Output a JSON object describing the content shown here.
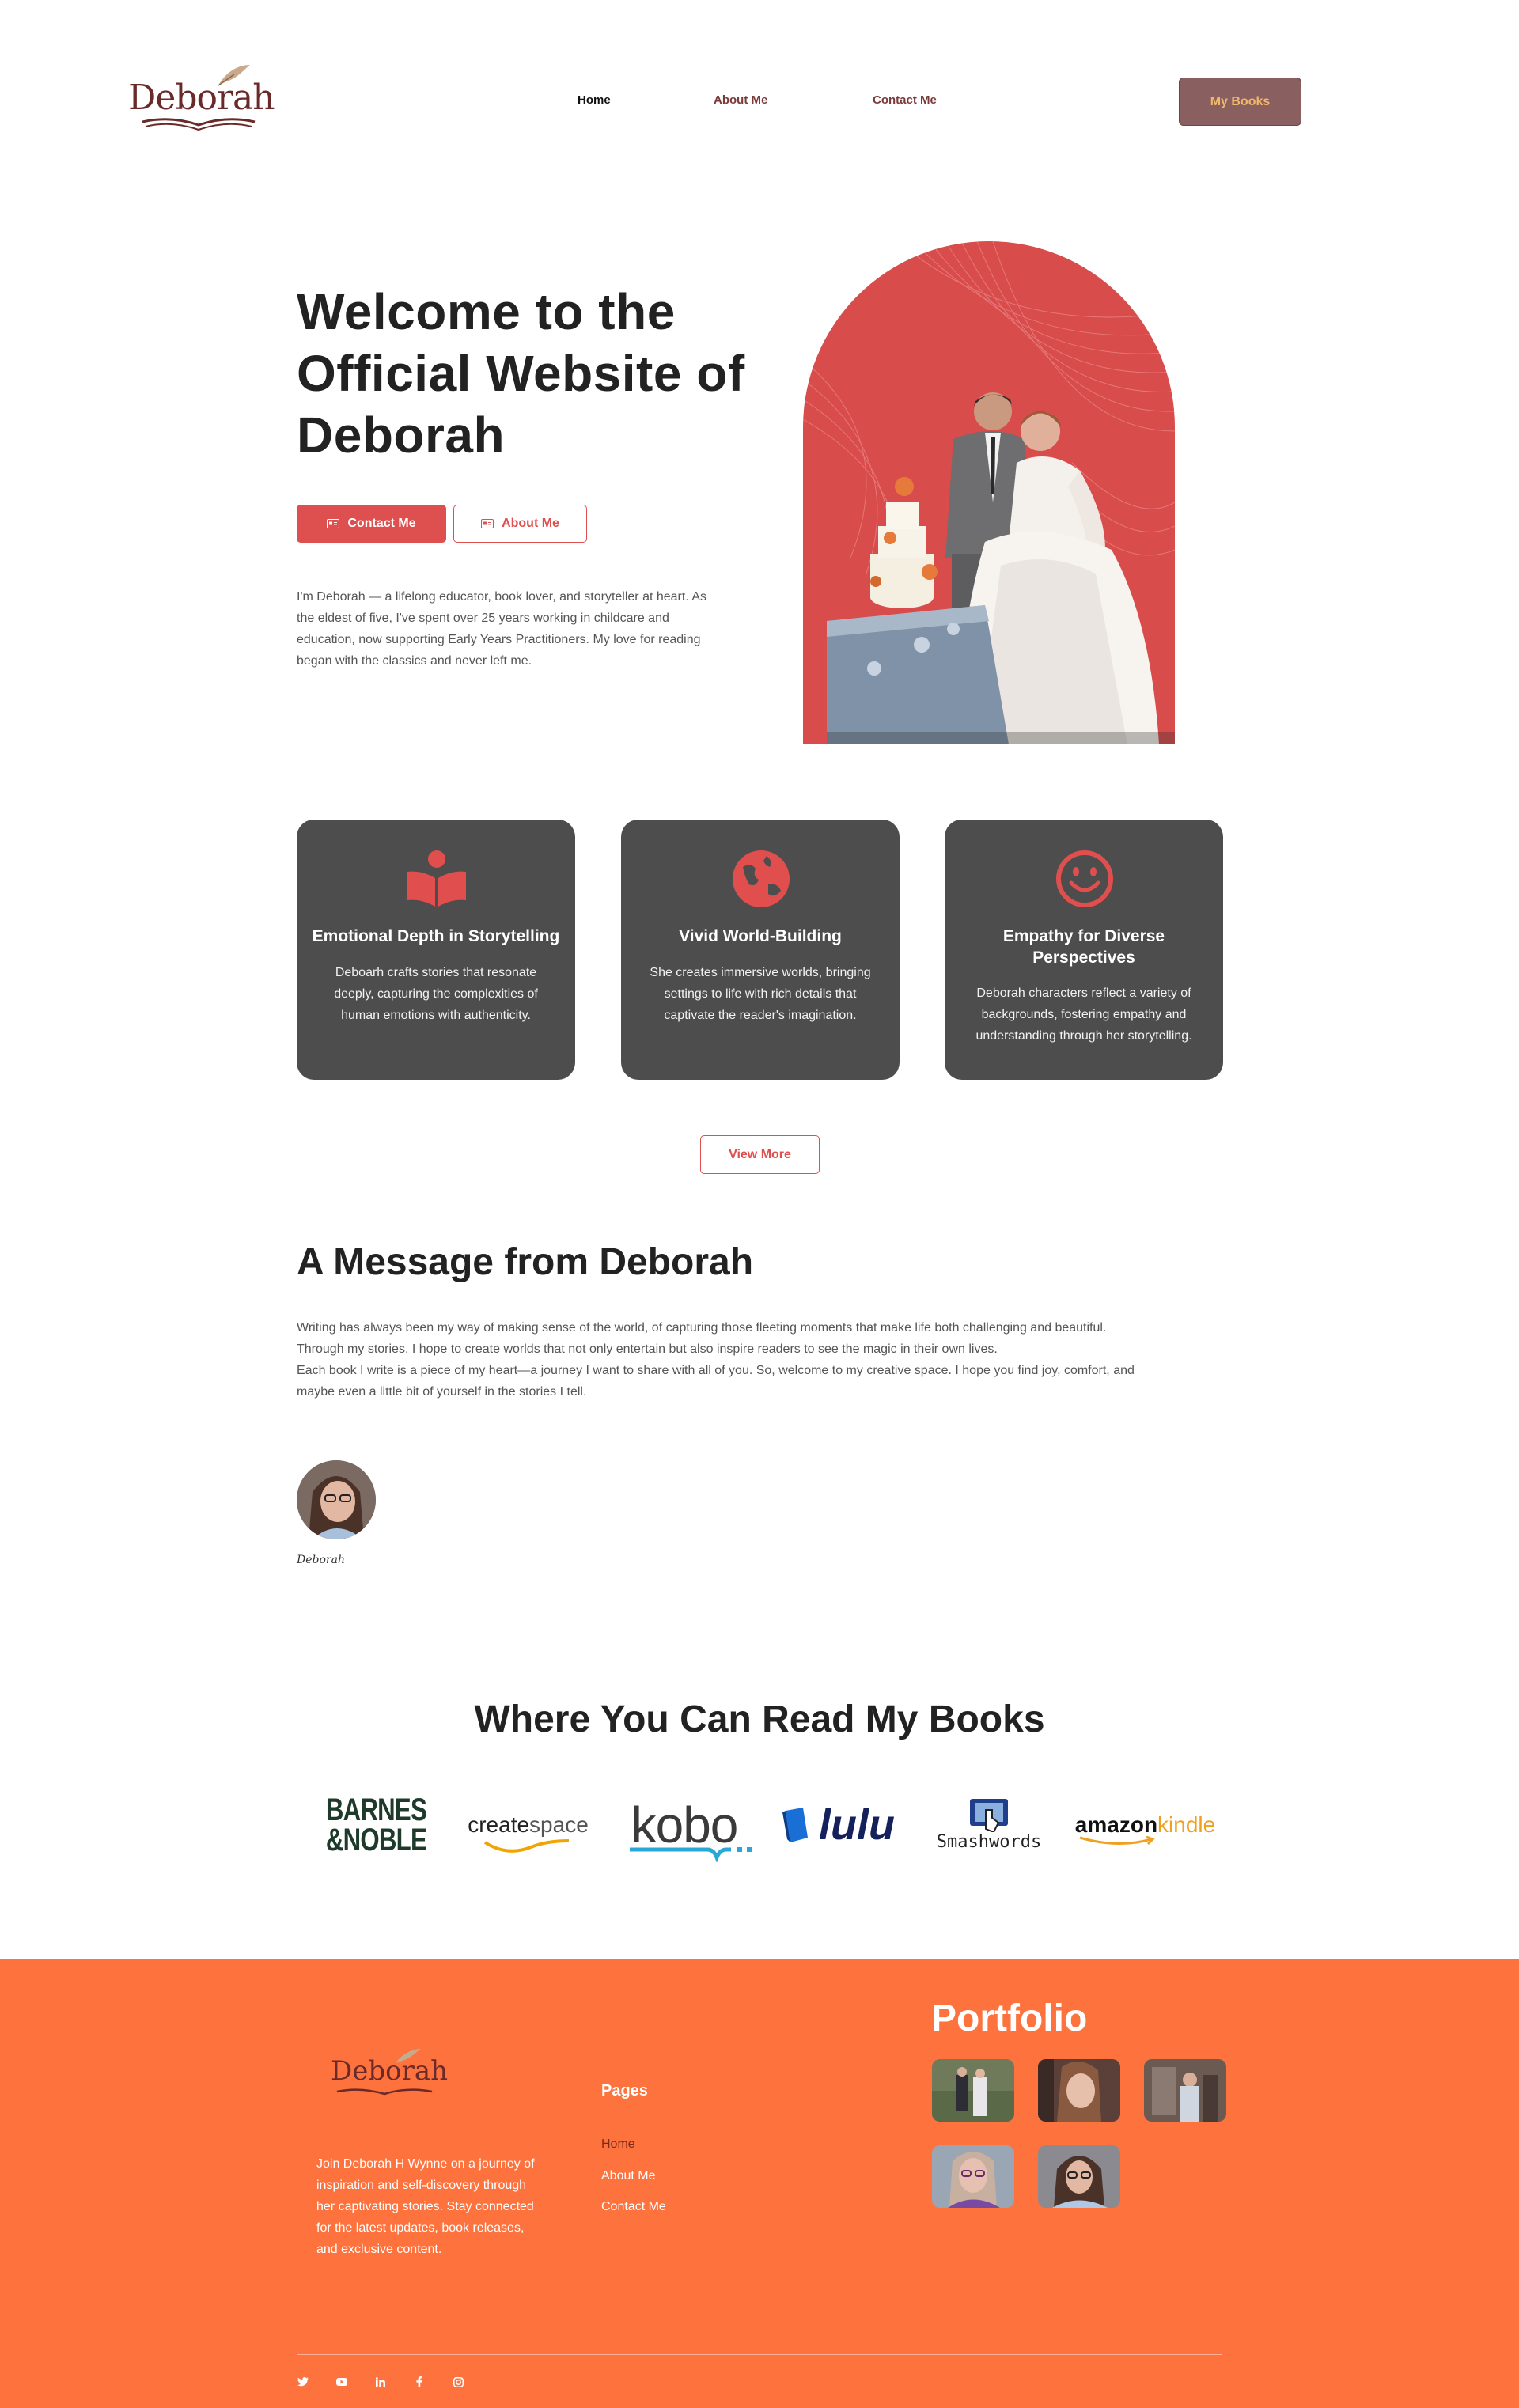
{
  "nav": {
    "logo_text": "Deborah",
    "links": [
      "Home",
      "About Me",
      "Contact Me"
    ],
    "cta": "My Books"
  },
  "hero": {
    "title": "Welcome to the Official Website of Deborah",
    "btn_contact": "Contact Me",
    "btn_about": "About Me",
    "paragraph": "I'm Deborah — a lifelong educator, book lover, and storyteller at heart. As the eldest of five, I've spent over 25 years working in childcare and education, now supporting Early Years Practitioners. My love for reading began with the classics and never left me."
  },
  "features": [
    {
      "icon": "reading-person-icon",
      "title": "Emotional Depth in Storytelling",
      "text": "Deboarh crafts stories that resonate deeply, capturing the complexities of human emotions with authenticity."
    },
    {
      "icon": "globe-icon",
      "title": "Vivid World-Building",
      "text": "She creates immersive worlds, bringing settings to life with rich details that captivate the reader's imagination."
    },
    {
      "icon": "smiley-icon",
      "title": "Empathy for Diverse Perspectives",
      "text": "Deborah characters reflect a variety of backgrounds, fostering empathy and understanding through her storytelling."
    }
  ],
  "view_more": "View More",
  "message": {
    "title": "A Message from Deborah",
    "para1": "Writing has always been my way of making sense of the world, of capturing those fleeting moments that make life both challenging and beautiful. Through my stories, I hope to create worlds that not only entertain but also inspire readers to see the magic in their own lives.",
    "para2": "Each book I write is a piece of my heart—a journey I want to share with all of you. So, welcome to my creative space. I hope you find joy, comfort, and maybe even a little bit of yourself in the stories I tell.",
    "signature": "Deborah"
  },
  "stores": {
    "title": "Where You Can Read My Books",
    "barnes_line1": "BARNES",
    "barnes_line2": "&NOBLE",
    "createspace_a": "create",
    "createspace_b": "space",
    "kobo": "kobo",
    "lulu": "lulu",
    "smashwords": "Smashwords",
    "amazon": "amazon",
    "kindle": "kindle"
  },
  "footer": {
    "logo_text": "Deborah",
    "about": "Join Deborah H Wynne on a journey of inspiration and self-discovery through her captivating stories. Stay connected for the latest updates, book releases, and exclusive content.",
    "pages_title": "Pages",
    "pages": [
      "Home",
      "About Me",
      "Contact Me"
    ],
    "portfolio_title": "Portfolio"
  },
  "colors": {
    "accent_red": "#de4f4f",
    "card_grey": "#4d4d4d",
    "footer_orange": "#fe723e",
    "nav_button": "#8a5f5f"
  }
}
